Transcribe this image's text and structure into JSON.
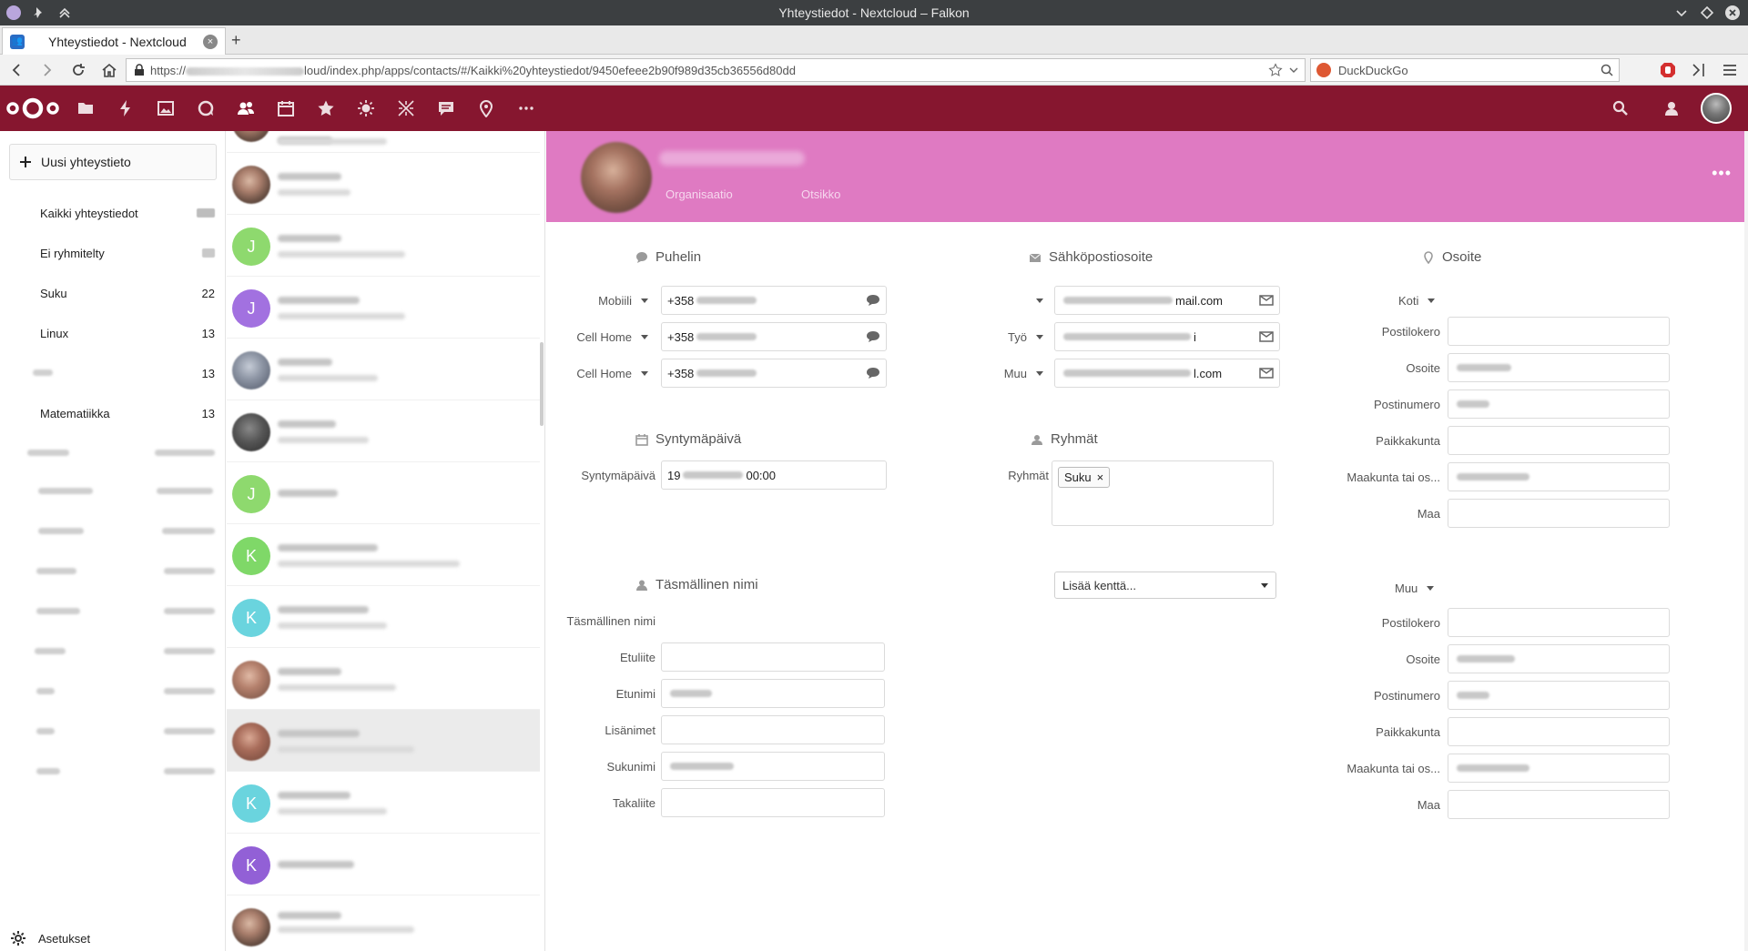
{
  "window": {
    "title": "Yhteystiedot - Nextcloud – Falkon"
  },
  "browser": {
    "tab_title": "Yhteystiedot - Nextcloud",
    "tab_close": "×",
    "new_tab": "+",
    "url_prefix": "https://",
    "url_suffix": "loud/index.php/apps/contacts/#/Kaikki%20yhteystiedot/9450efeee2b90f989d35cb36556d80dd",
    "search_engine": "DuckDuckGo"
  },
  "app_nav": {
    "icons": [
      "files-icon",
      "activity-icon",
      "gallery-icon",
      "talk-icon",
      "contacts-icon",
      "calendar-icon",
      "bookmarks-icon",
      "weather-icon",
      "deck-icon",
      "news-icon",
      "maps-icon",
      "more-apps-icon"
    ]
  },
  "sidebar": {
    "new_contact": "Uusi yhteystieto",
    "items": [
      {
        "label": "Kaikki yhteystiedot",
        "count": ""
      },
      {
        "label": "Ei ryhmitelty",
        "count": ""
      },
      {
        "label": "Suku",
        "count": "22"
      },
      {
        "label": "Linux",
        "count": "13"
      },
      {
        "label": "",
        "count": "13"
      },
      {
        "label": "Matematiikka",
        "count": "13"
      }
    ],
    "settings": "Asetukset"
  },
  "contacts": [
    {
      "initial": "",
      "color": "#777"
    },
    {
      "initial": "",
      "color": "#777"
    },
    {
      "initial": "J",
      "color": "#8ed96e"
    },
    {
      "initial": "J",
      "color": "#a271e0"
    },
    {
      "initial": "",
      "color": "#777"
    },
    {
      "initial": "",
      "color": "#555"
    },
    {
      "initial": "J",
      "color": "#8ed96e"
    },
    {
      "initial": "K",
      "color": "#7fd868"
    },
    {
      "initial": "K",
      "color": "#6ad4de"
    },
    {
      "initial": "",
      "color": "#777"
    },
    {
      "initial": "",
      "color": "#777"
    },
    {
      "initial": "K",
      "color": "#6ad4de"
    },
    {
      "initial": "K",
      "color": "#9260d6"
    },
    {
      "initial": "",
      "color": "#777"
    }
  ],
  "details": {
    "header": {
      "organization": "Organisaatio",
      "title": "Otsikko",
      "more": "•••"
    },
    "phone": {
      "heading": "Puhelin",
      "rows": [
        {
          "type": "Mobiili",
          "value": "+358"
        },
        {
          "type": "Cell Home",
          "value": "+358"
        },
        {
          "type": "Cell Home",
          "value": "+358"
        }
      ]
    },
    "email": {
      "heading": "Sähköpostiosoite",
      "rows": [
        {
          "type": "",
          "value_end": "mail.com"
        },
        {
          "type": "Työ",
          "value_end": "i"
        },
        {
          "type": "Muu",
          "value_end": "l.com"
        }
      ]
    },
    "address_home": {
      "heading": "Osoite",
      "type": "Koti",
      "labels": [
        "Postilokero",
        "Osoite",
        "Postinumero",
        "Paikkakunta",
        "Maakunta tai os...",
        "Maa"
      ]
    },
    "birthday": {
      "heading": "Syntymäpäivä",
      "label": "Syntymäpäivä",
      "value_start": "19",
      "value_end": "00:00"
    },
    "groups": {
      "heading": "Ryhmät",
      "label": "Ryhmät",
      "tag": "Suku",
      "tag_remove": "×"
    },
    "formatted_name": {
      "heading": "Täsmällinen nimi",
      "label": "Täsmällinen nimi",
      "labels": [
        "Etuliite",
        "Etunimi",
        "Lisänimet",
        "Sukunimi",
        "Takaliite"
      ]
    },
    "add_field": "Lisää kenttä...",
    "address_other": {
      "type": "Muu",
      "labels": [
        "Postilokero",
        "Osoite",
        "Postinumero",
        "Paikkakunta",
        "Maakunta tai os...",
        "Maa"
      ]
    }
  },
  "colors": {
    "nc_header": "#86162f",
    "contact_header": "#df7ac2"
  }
}
